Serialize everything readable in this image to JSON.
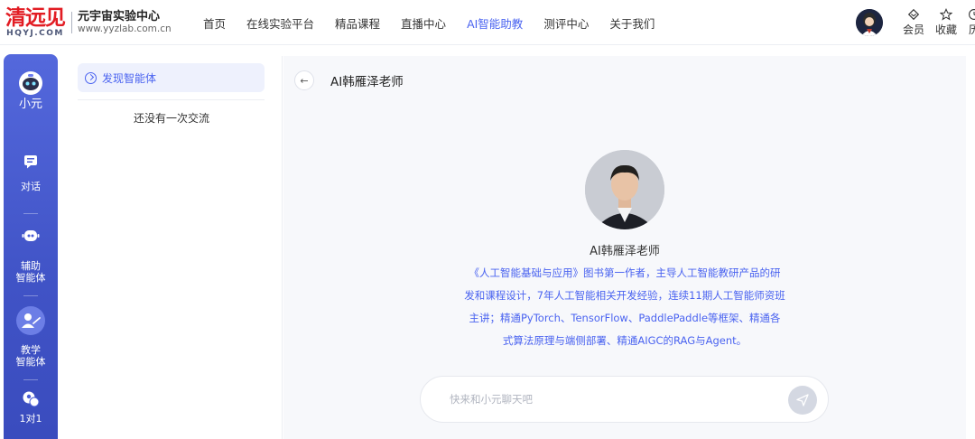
{
  "logo": {
    "brand": "清远见",
    "brand_sub": "HQYJ.COM",
    "name": "元宇宙实验中心",
    "url": "www.yyzlab.com.cn"
  },
  "nav": {
    "items": [
      {
        "label": "首页"
      },
      {
        "label": "在线实验平台"
      },
      {
        "label": "精品课程"
      },
      {
        "label": "直播中心"
      },
      {
        "label": "AI智能助教",
        "active": true
      },
      {
        "label": "测评中心"
      },
      {
        "label": "关于我们"
      }
    ]
  },
  "header_right": {
    "member": "会员",
    "favorites": "收藏",
    "history": "历"
  },
  "sidebar": {
    "brand_label": "小元",
    "items": [
      {
        "label": "对话",
        "icon": "chat-icon"
      },
      {
        "label": "辅助\n智能体",
        "icon": "robot-icon"
      },
      {
        "label": "教学\n智能体",
        "icon": "teacher-icon"
      },
      {
        "label": "1对1",
        "icon": "tutor-icon"
      }
    ]
  },
  "left_panel": {
    "discover_label": "发现智能体",
    "empty_text": "还没有一次交流"
  },
  "chat": {
    "title": "AI韩雁泽老师",
    "agent_name": "AI韩雁泽老师",
    "agent_desc": "《人工智能基础与应用》图书第一作者，主导人工智能教研产品的研发和课程设计，7年人工智能相关开发经验，连续11期人工智能师资班主讲；精通PyTorch、TensorFlow、PaddlePaddle等框架、精通各式算法原理与端侧部署、精通AIGC的RAG与Agent。",
    "input_placeholder": "快来和小元聊天吧"
  },
  "colors": {
    "accent": "#4a63f0",
    "sidebar": "#4a5dd6",
    "brand_red": "#e21c23"
  }
}
